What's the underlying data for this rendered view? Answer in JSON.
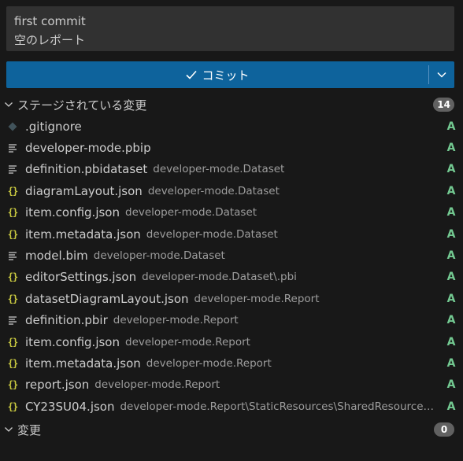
{
  "commit_message": {
    "line1": "first commit",
    "line2": "空のレポート"
  },
  "commit_button": {
    "label": "コミット",
    "check_icon": "check-icon",
    "dropdown_icon": "chevron-down-icon"
  },
  "staged": {
    "title": "ステージされている変更",
    "count": "14",
    "files": [
      {
        "icon": "git",
        "name": ".gitignore",
        "dir": "",
        "status": "A"
      },
      {
        "icon": "lines",
        "name": "developer-mode.pbip",
        "dir": "",
        "status": "A"
      },
      {
        "icon": "lines",
        "name": "definition.pbidataset",
        "dir": "developer-mode.Dataset",
        "status": "A"
      },
      {
        "icon": "json",
        "name": "diagramLayout.json",
        "dir": "developer-mode.Dataset",
        "status": "A"
      },
      {
        "icon": "json",
        "name": "item.config.json",
        "dir": "developer-mode.Dataset",
        "status": "A"
      },
      {
        "icon": "json",
        "name": "item.metadata.json",
        "dir": "developer-mode.Dataset",
        "status": "A"
      },
      {
        "icon": "lines",
        "name": "model.bim",
        "dir": "developer-mode.Dataset",
        "status": "A"
      },
      {
        "icon": "json",
        "name": "editorSettings.json",
        "dir": "developer-mode.Dataset\\.pbi",
        "status": "A"
      },
      {
        "icon": "json",
        "name": "datasetDiagramLayout.json",
        "dir": "developer-mode.Report",
        "status": "A"
      },
      {
        "icon": "lines",
        "name": "definition.pbir",
        "dir": "developer-mode.Report",
        "status": "A"
      },
      {
        "icon": "json",
        "name": "item.config.json",
        "dir": "developer-mode.Report",
        "status": "A"
      },
      {
        "icon": "json",
        "name": "item.metadata.json",
        "dir": "developer-mode.Report",
        "status": "A"
      },
      {
        "icon": "json",
        "name": "report.json",
        "dir": "developer-mode.Report",
        "status": "A"
      },
      {
        "icon": "json",
        "name": "CY23SU04.json",
        "dir": "developer-mode.Report\\StaticResources\\SharedResources\\Ba...",
        "status": "A"
      }
    ]
  },
  "changes": {
    "title": "変更",
    "count": "0"
  },
  "colors": {
    "background": "#181818",
    "commit_button": "#0e639c",
    "added_status": "#73c991",
    "json_icon": "#cbcb41"
  }
}
